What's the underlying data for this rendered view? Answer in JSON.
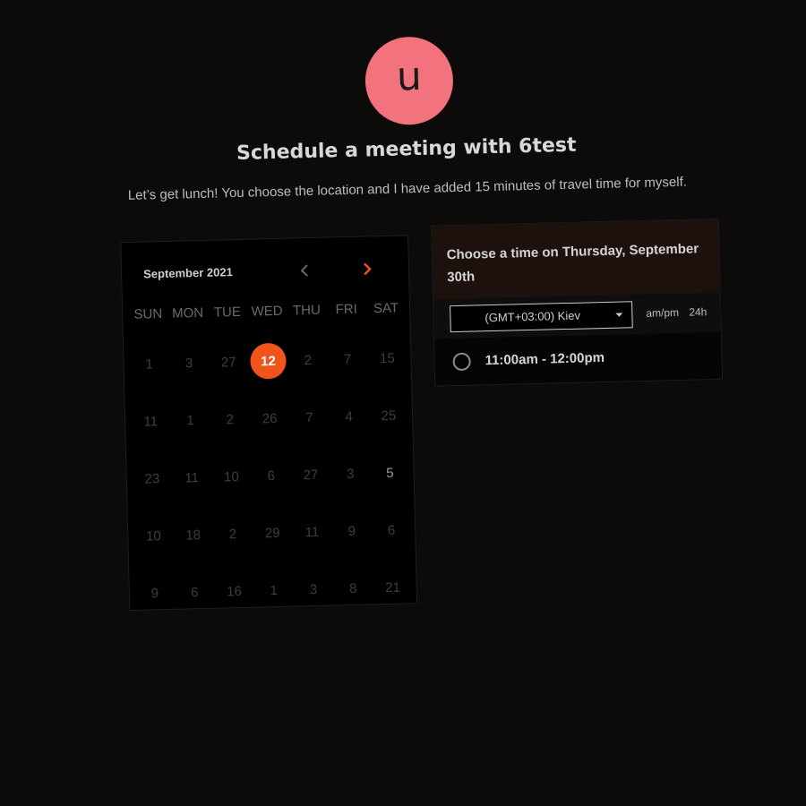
{
  "avatar": {
    "initial": "u",
    "color": "#f2727e"
  },
  "title": "Schedule a meeting with 6test",
  "description": "Let’s get lunch! You choose the location and I have added 15 minutes of travel time for myself.",
  "calendar": {
    "month_label": "September 2021",
    "prev_icon": "chevron-left-icon",
    "next_icon": "chevron-right-icon",
    "accent_color": "#f0541a",
    "weekdays": [
      "SUN",
      "MON",
      "TUE",
      "WED",
      "THU",
      "FRI",
      "SAT"
    ],
    "days": [
      "1",
      "3",
      "27",
      "12",
      "2",
      "7",
      "15",
      "11",
      "1",
      "2",
      "26",
      "7",
      "4",
      "25",
      "23",
      "11",
      "10",
      "6",
      "27",
      "3",
      "5",
      "10",
      "18",
      "2",
      "29",
      "11",
      "9",
      "6",
      "9",
      "6",
      "16",
      "1",
      "3",
      "8",
      "21"
    ],
    "selected_day": "12",
    "bright_day_index": 20
  },
  "time_panel": {
    "heading": "Choose a time on Thursday, September 30th",
    "timezone": "(GMT+03:00) Kiev",
    "format_ampm": "am/pm",
    "format_24h": "24h",
    "slots": [
      {
        "label": "11:00am - 12:00pm"
      }
    ]
  }
}
